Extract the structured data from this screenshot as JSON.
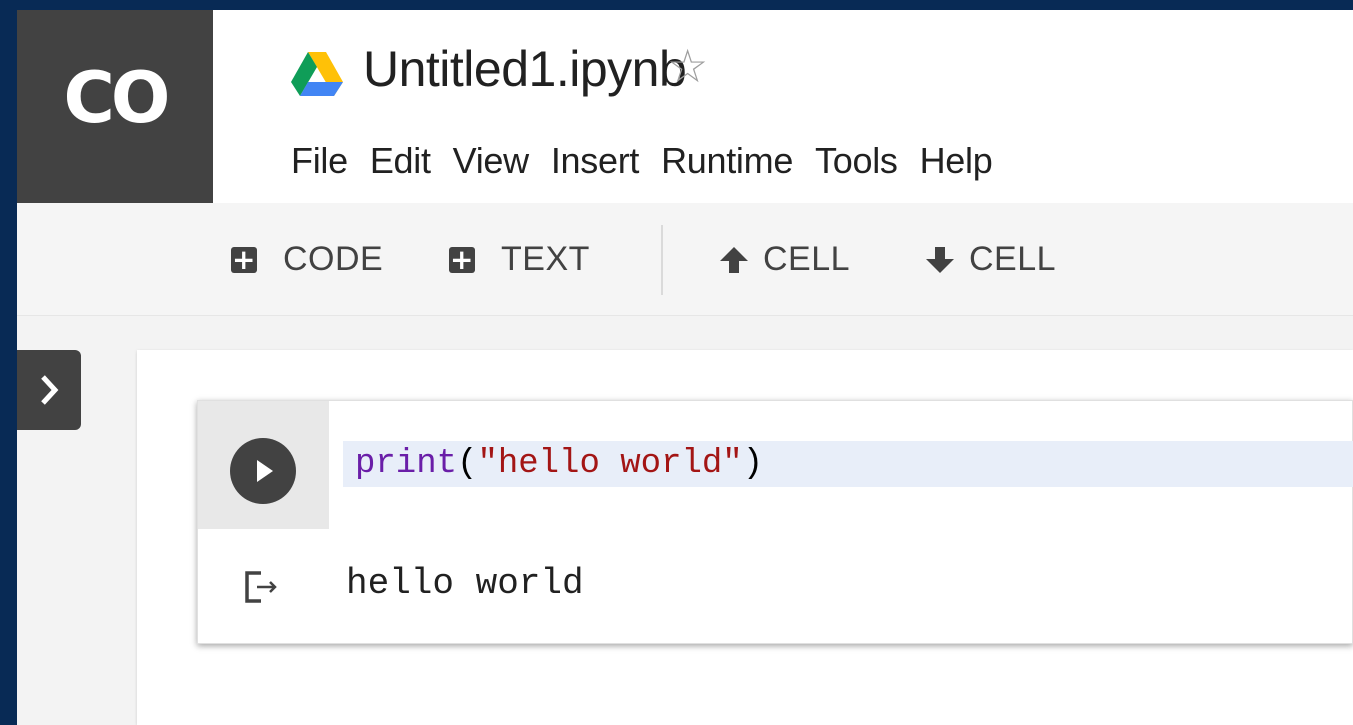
{
  "app": {
    "logo_text": "CO"
  },
  "document": {
    "title": "Untitled1.ipynb",
    "drive_icon": "google-drive-icon",
    "star_icon": "star-outline-icon"
  },
  "menu": {
    "items": [
      {
        "label": "File"
      },
      {
        "label": "Edit"
      },
      {
        "label": "View"
      },
      {
        "label": "Insert"
      },
      {
        "label": "Runtime"
      },
      {
        "label": "Tools"
      },
      {
        "label": "Help"
      }
    ]
  },
  "toolbar": {
    "add_code_label": "CODE",
    "add_text_label": "TEXT",
    "cell_up_label": "CELL",
    "cell_down_label": "CELL"
  },
  "cell": {
    "code": {
      "func": "print",
      "open": "(",
      "string": "\"hello world\"",
      "close": ")"
    },
    "output": "hello world"
  },
  "colors": {
    "background": "#082a55",
    "logo_bg": "#424242",
    "code_highlight": "#e8eef9",
    "keyword": "#6a1ea8",
    "string": "#a31515"
  }
}
